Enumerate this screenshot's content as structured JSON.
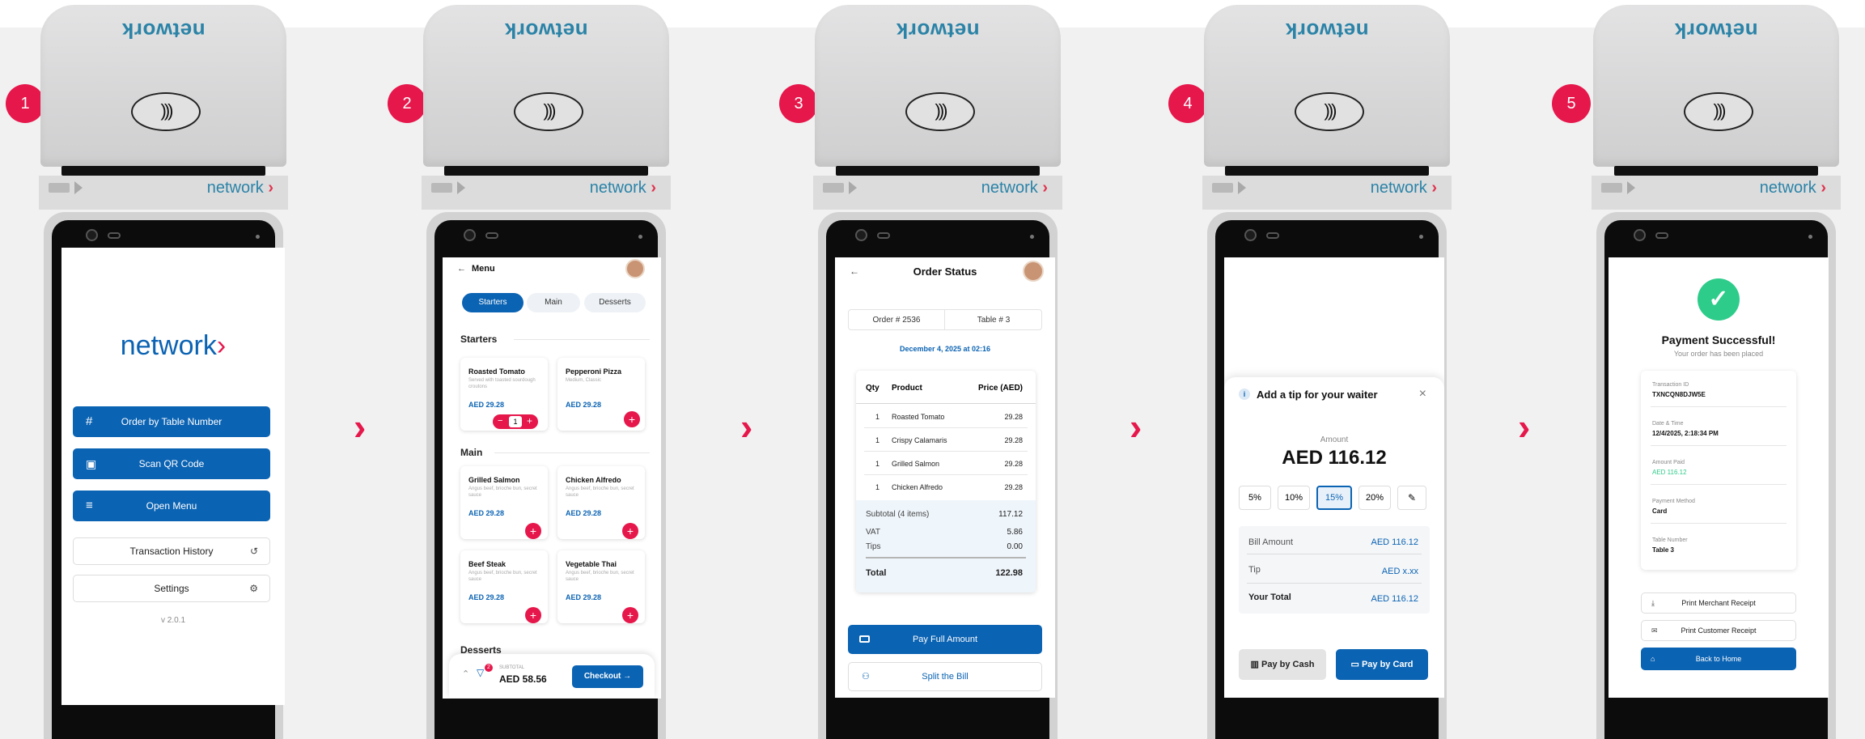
{
  "brand": {
    "name": "network",
    "arrow": "›"
  },
  "nfc_glyph": ")))",
  "steps": [
    "1",
    "2",
    "3",
    "4",
    "5"
  ],
  "next_arrow": "›",
  "s1": {
    "order_table": "Order by Table Number",
    "scan_qr": "Scan QR Code",
    "open_menu": "Open Menu",
    "transaction_history": "Transaction History",
    "settings": "Settings",
    "version": "v 2.0.1",
    "hash": "#",
    "qr": "▣",
    "menu": "≡",
    "history": "↺",
    "gear": "⚙"
  },
  "s2": {
    "back": "←",
    "title": "Menu",
    "tabs": [
      "Starters",
      "Main",
      "Desserts"
    ],
    "sections": [
      "Starters",
      "Main",
      "Desserts"
    ],
    "items": [
      {
        "name": "Roasted Tomato",
        "desc": "Served with toasted sourdough croutons",
        "price": "AED 29.28"
      },
      {
        "name": "Pepperoni Pizza",
        "desc": "Medium, Classic",
        "price": "AED 29.28"
      },
      {
        "name": "Grilled Salmon",
        "desc": "Angus beef, brioche bun, secret sauce",
        "price": "AED 29.28"
      },
      {
        "name": "Chicken Alfredo",
        "desc": "Angus beef, brioche bun, secret sauce",
        "price": "AED 29.28"
      },
      {
        "name": "Beef Steak",
        "desc": "Angus beef, brioche bun, secret sauce",
        "price": "AED 29.28"
      },
      {
        "name": "Vegetable Thai",
        "desc": "Angus beef, brioche bun, secret sauce",
        "price": "AED 29.28"
      }
    ],
    "qty": "1",
    "minus": "−",
    "plus": "+",
    "cart_count": "2",
    "subtotal_label": "SUBTOTAL",
    "subtotal": "AED 58.56",
    "checkout": "Checkout",
    "checkout_arrow": "→",
    "collapse": "⌃",
    "cart_icon": "🛒"
  },
  "s3": {
    "back": "←",
    "title": "Order Status",
    "order": "Order # 2536",
    "table": "Table # 3",
    "date": "December 4, 2025 at 02:16",
    "headers": [
      "Qty",
      "Product",
      "Price (AED)"
    ],
    "rows": [
      {
        "qty": "1",
        "product": "Roasted Tomato",
        "price": "29.28"
      },
      {
        "qty": "1",
        "product": "Crispy Calamaris",
        "price": "29.28"
      },
      {
        "qty": "1",
        "product": "Grilled Salmon",
        "price": "29.28"
      },
      {
        "qty": "1",
        "product": "Chicken Alfredo",
        "price": "29.28"
      }
    ],
    "subtotal_label": "Subtotal (4 items)",
    "subtotal": "117.12",
    "vat_label": "VAT",
    "vat": "5.86",
    "tips_label": "Tips",
    "tips": "0.00",
    "total_label": "Total",
    "total": "122.98",
    "pay_full": "Pay Full Amount",
    "split": "Split the Bill"
  },
  "s4": {
    "info": "i",
    "title": "Add a tip for your waiter",
    "close": "×",
    "amount_label": "Amount",
    "amount": "AED 116.12",
    "tips": [
      "5%",
      "10%",
      "15%",
      "20%"
    ],
    "selected_tip": "15%",
    "edit": "✎",
    "bill_label": "Bill Amount",
    "bill": "AED 116.12",
    "tip_label": "Tip",
    "tip": "AED x.xx",
    "total_label": "Your Total",
    "total": "AED 116.12",
    "cash": "Pay by Cash",
    "card": "Pay by Card"
  },
  "s5": {
    "check": "✓",
    "title": "Payment Successful!",
    "subtitle": "Your order has been placed",
    "fields": [
      {
        "label": "Transaction ID",
        "value": "TXNCQN8DJW5E"
      },
      {
        "label": "Date & Time",
        "value": "12/4/2025, 2:18:34 PM"
      },
      {
        "label": "Amount Paid",
        "value": "AED 116.12"
      },
      {
        "label": "Payment Method",
        "value": "Card"
      },
      {
        "label": "Table Number",
        "value": "Table 3"
      }
    ],
    "merchant": "Print Merchant Receipt",
    "customer": "Print Customer Receipt",
    "home": "Back to Home"
  },
  "colors": {
    "accent": "#e6174b",
    "primary": "#0b63b3",
    "success": "#2ecc8a",
    "brand": "#2b83a7"
  }
}
